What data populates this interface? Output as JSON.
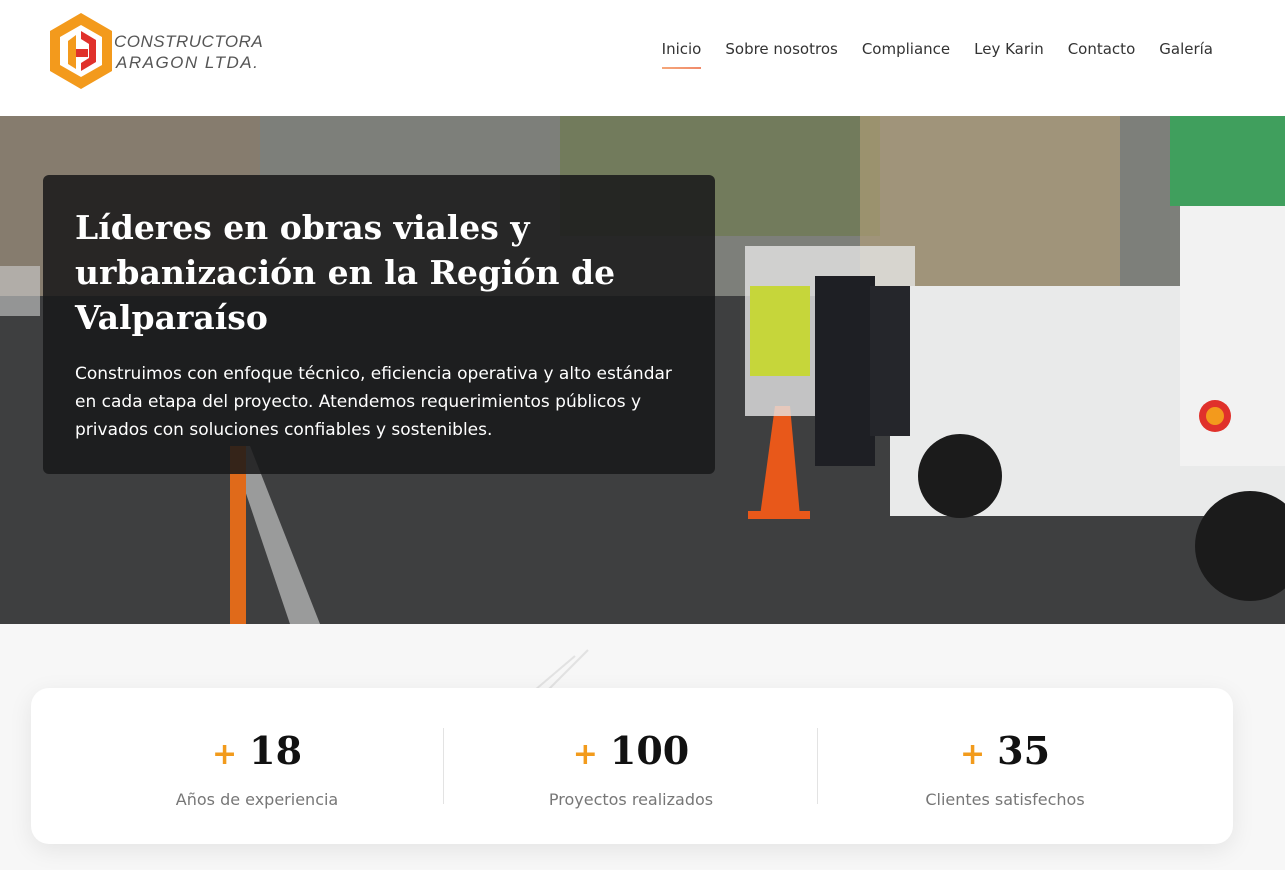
{
  "brand": {
    "line1": "CONSTRUCTORA",
    "line2": "ARAGON LTDA.",
    "colors": {
      "orange": "#f39a1c",
      "red": "#e0312b"
    }
  },
  "nav": {
    "items": [
      {
        "label": "Inicio",
        "active": true
      },
      {
        "label": "Sobre nosotros",
        "active": false
      },
      {
        "label": "Compliance",
        "active": false
      },
      {
        "label": "Ley Karin",
        "active": false
      },
      {
        "label": "Contacto",
        "active": false
      },
      {
        "label": "Galería",
        "active": false
      }
    ]
  },
  "hero": {
    "title": "Líderes en obras viales y urbanización en la Región de Valparaíso",
    "text": "Construimos con enfoque técnico, eficiencia operativa y alto estándar en cada etapa del proyecto. Atendemos requerimientos públicos y privados con soluciones confiables y sostenibles."
  },
  "stats": [
    {
      "plus": "+",
      "value": "18",
      "label": "Años de experiencia"
    },
    {
      "plus": "+",
      "value": "100",
      "label": "Proyectos realizados"
    },
    {
      "plus": "+",
      "value": "35",
      "label": "Clientes satisfechos"
    }
  ]
}
